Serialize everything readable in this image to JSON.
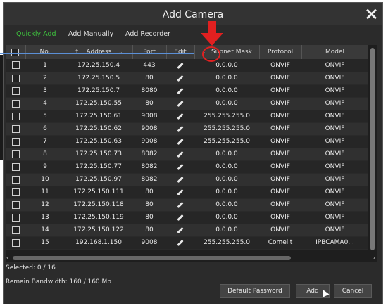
{
  "dialog": {
    "title": "Add Camera"
  },
  "tabs": [
    {
      "label": "Quickly Add",
      "active": true
    },
    {
      "label": "Add Manually",
      "active": false
    },
    {
      "label": "Add Recorder",
      "active": false
    }
  ],
  "table": {
    "headers": {
      "no": "No.",
      "address": "Address",
      "port": "Port",
      "edit": "Edit",
      "subnet": "Subnet Mask",
      "protocol": "Protocol",
      "model": "Model"
    },
    "rows": [
      {
        "no": "1",
        "address": "172.25.150.4",
        "port": "443",
        "subnet": "0.0.0.0",
        "protocol": "ONVIF",
        "model": "ONVIF"
      },
      {
        "no": "2",
        "address": "172.25.150.5",
        "port": "80",
        "subnet": "0.0.0.0",
        "protocol": "ONVIF",
        "model": "ONVIF"
      },
      {
        "no": "3",
        "address": "172.25.150.7",
        "port": "8080",
        "subnet": "0.0.0.0",
        "protocol": "ONVIF",
        "model": "ONVIF"
      },
      {
        "no": "4",
        "address": "172.25.150.55",
        "port": "80",
        "subnet": "0.0.0.0",
        "protocol": "ONVIF",
        "model": "ONVIF"
      },
      {
        "no": "5",
        "address": "172.25.150.61",
        "port": "9008",
        "subnet": "255.255.255.0",
        "protocol": "ONVIF",
        "model": "ONVIF"
      },
      {
        "no": "6",
        "address": "172.25.150.62",
        "port": "9008",
        "subnet": "255.255.255.0",
        "protocol": "ONVIF",
        "model": "ONVIF"
      },
      {
        "no": "7",
        "address": "172.25.150.63",
        "port": "9008",
        "subnet": "255.255.255.0",
        "protocol": "ONVIF",
        "model": "ONVIF"
      },
      {
        "no": "8",
        "address": "172.25.150.73",
        "port": "8082",
        "subnet": "0.0.0.0",
        "protocol": "ONVIF",
        "model": "ONVIF"
      },
      {
        "no": "9",
        "address": "172.25.150.77",
        "port": "8082",
        "subnet": "0.0.0.0",
        "protocol": "ONVIF",
        "model": "ONVIF"
      },
      {
        "no": "10",
        "address": "172.25.150.97",
        "port": "8082",
        "subnet": "0.0.0.0",
        "protocol": "ONVIF",
        "model": "ONVIF"
      },
      {
        "no": "11",
        "address": "172.25.150.111",
        "port": "80",
        "subnet": "0.0.0.0",
        "protocol": "ONVIF",
        "model": "ONVIF"
      },
      {
        "no": "12",
        "address": "172.25.150.118",
        "port": "80",
        "subnet": "0.0.0.0",
        "protocol": "ONVIF",
        "model": "ONVIF"
      },
      {
        "no": "13",
        "address": "172.25.150.119",
        "port": "80",
        "subnet": "0.0.0.0",
        "protocol": "ONVIF",
        "model": "ONVIF"
      },
      {
        "no": "14",
        "address": "172.25.150.122",
        "port": "80",
        "subnet": "0.0.0.0",
        "protocol": "ONVIF",
        "model": "ONVIF"
      },
      {
        "no": "15",
        "address": "192.168.1.150",
        "port": "9008",
        "subnet": "255.255.255.0",
        "protocol": "Comelit",
        "model": "IPBCAMA0..."
      }
    ]
  },
  "footer": {
    "selected": "Selected: 0 / 16",
    "bandwidth": "Remain Bandwidth: 160 / 160 Mb",
    "default_password": "Default Password",
    "add": "Add",
    "cancel": "Cancel"
  },
  "icons": {
    "close": "close-icon",
    "edit": "pencil-icon",
    "sort_up": "arrow-up-icon",
    "sort_down": "chevron-down-icon"
  },
  "colors": {
    "accent_tab": "#3ec13e",
    "annotation": "#e12020"
  }
}
